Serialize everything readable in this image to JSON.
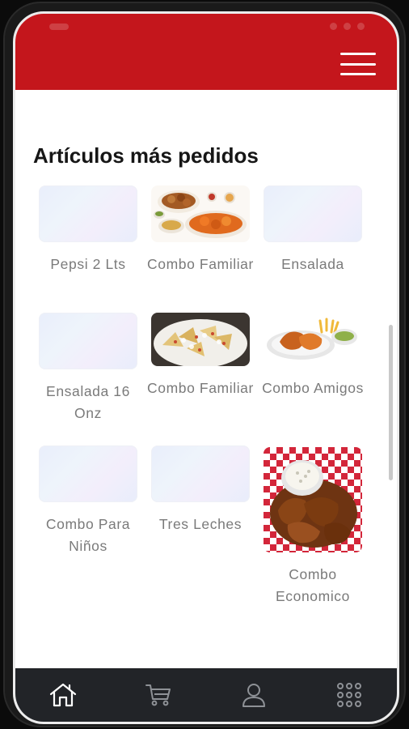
{
  "header": {
    "menu_icon": "hamburger-menu-icon",
    "bar_color": "#c4161c"
  },
  "section": {
    "title": "Artículos más pedidos"
  },
  "items": [
    {
      "label": "Pepsi 2 Lts",
      "image": "placeholder"
    },
    {
      "label": "Combo Familiar",
      "image": "wings-platter-photo"
    },
    {
      "label": "Ensalada",
      "image": "placeholder"
    },
    {
      "label": "Ensalada 16 Onz",
      "image": "placeholder"
    },
    {
      "label": "Combo Familiar",
      "image": "nachos-photo"
    },
    {
      "label": "Combo Amigos",
      "image": "chicken-fries-photo"
    },
    {
      "label": "Combo Para Niños",
      "image": "placeholder"
    },
    {
      "label": "Tres Leches",
      "image": "placeholder"
    },
    {
      "label": "Combo Economico",
      "image": "wings-basket-photo"
    }
  ],
  "nav": [
    {
      "name": "home",
      "icon": "home-icon"
    },
    {
      "name": "cart",
      "icon": "cart-icon"
    },
    {
      "name": "profile",
      "icon": "user-icon"
    },
    {
      "name": "more",
      "icon": "grid-icon"
    }
  ]
}
